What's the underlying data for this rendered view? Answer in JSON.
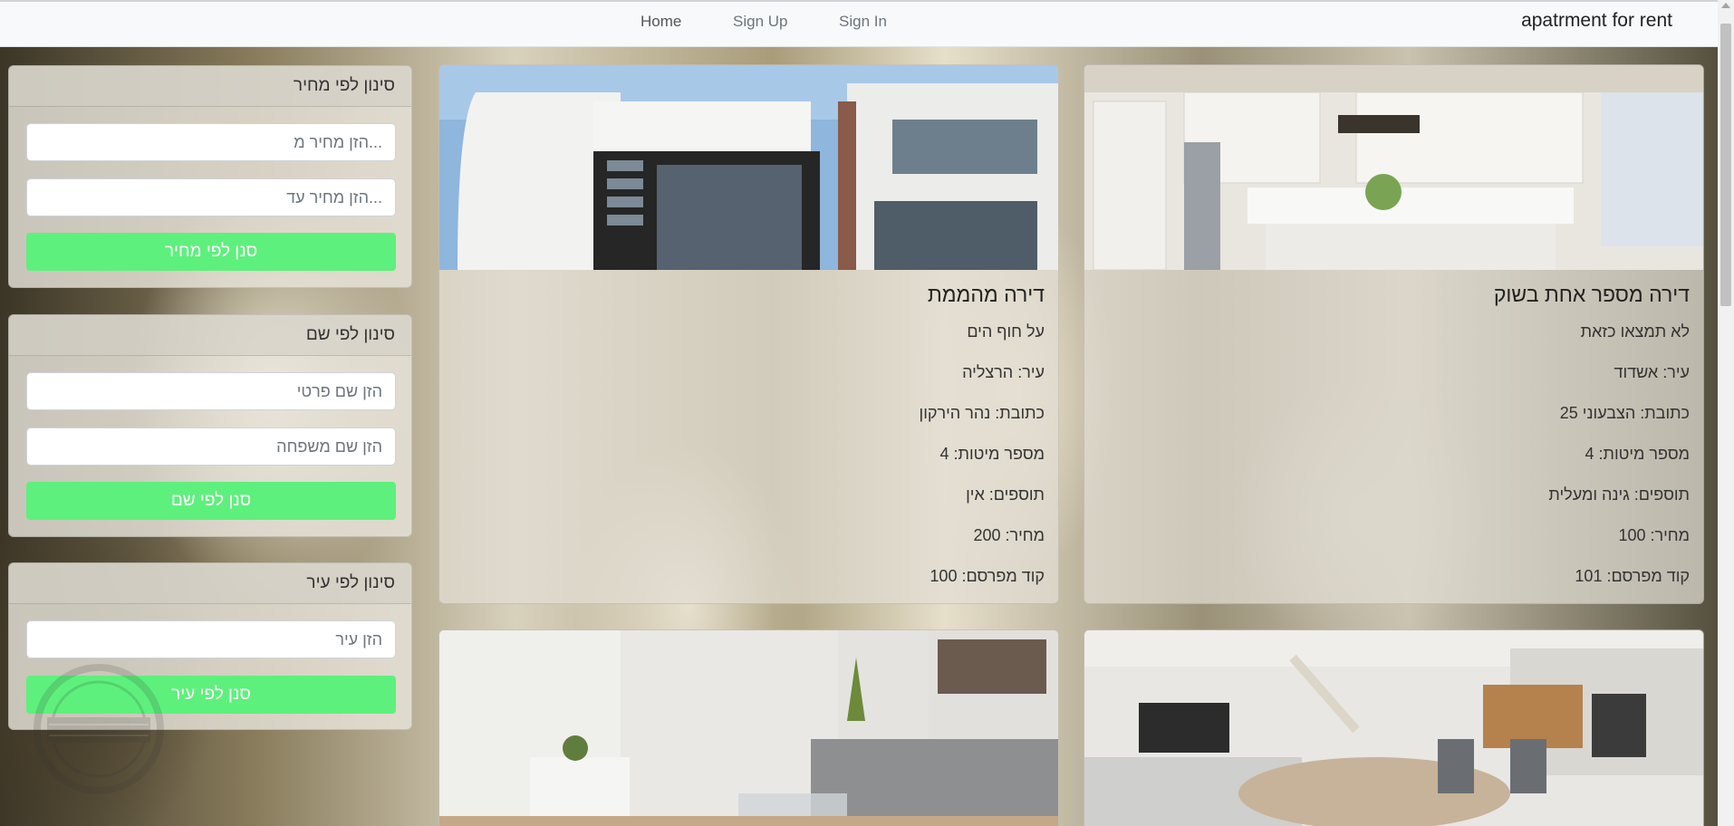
{
  "navbar": {
    "brand": "apatrment for rent",
    "links": [
      "Home",
      "Sign Up",
      "Sign In"
    ]
  },
  "filters": {
    "price": {
      "title": "סינון לפי מחיר",
      "from_placeholder": "...הזן מחיר מ",
      "to_placeholder": "...הזן מחיר עד",
      "button": "סנן לפי מחיר"
    },
    "name": {
      "title": "סינון לפי שם",
      "first_placeholder": "הזן שם פרטי",
      "last_placeholder": "הזן שם משפחה",
      "button": "סנן לפי שם"
    },
    "city": {
      "title": "סינון לפי עיר",
      "city_placeholder": "הזן עיר",
      "button": "סנן לפי עיר"
    }
  },
  "labels": {
    "city": "עיר:",
    "address": "כתובת:",
    "beds": "מספר מיטות:",
    "extras": "תוספים:",
    "price": "מחיר:",
    "advertiser": "קוד מפרסם:"
  },
  "apartments": [
    {
      "title": "דירה מספר אחת בשוק",
      "description": "לא תמצאו כזאת",
      "city": "אשדוד",
      "address": "הצבעוני 25",
      "beds": "4",
      "extras": "גינה ומעלית",
      "price": "100",
      "advertiser": "101",
      "image": "kitchen-photo"
    },
    {
      "title": "דירה מהממת",
      "description": "על חוף הים",
      "city": "הרצליה",
      "address": "נהר הירקון",
      "beds": "4",
      "extras": "אין",
      "price": "200",
      "advertiser": "100",
      "image": "modern-house-photo"
    },
    {
      "image": "dining-room-photo"
    },
    {
      "image": "living-room-photo"
    }
  ],
  "colors": {
    "filter_button": "#5ef07c",
    "navbar": "#f8f9fa"
  },
  "watermark": "NETFREE"
}
